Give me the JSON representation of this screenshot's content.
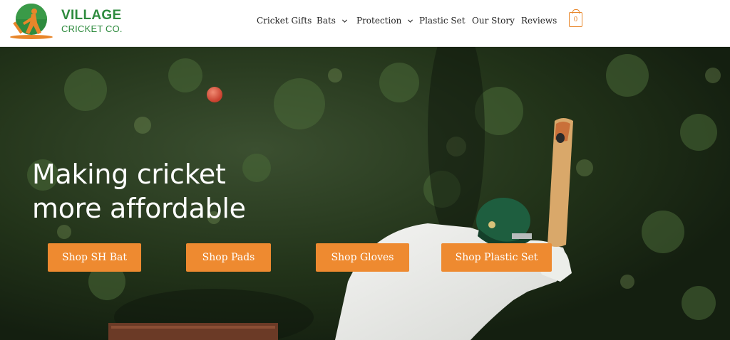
{
  "brand": {
    "name_line1": "VILLAGE",
    "name_line2": "CRICKET CO.",
    "green": "#2e8b3e",
    "orange": "#e8862a"
  },
  "nav": {
    "items": [
      {
        "label": "Cricket Gifts",
        "has_dropdown": false
      },
      {
        "label": "Bats",
        "has_dropdown": true
      },
      {
        "label": "Protection",
        "has_dropdown": true
      },
      {
        "label": "Plastic Set",
        "has_dropdown": false
      },
      {
        "label": "Our Story",
        "has_dropdown": false
      },
      {
        "label": "Reviews",
        "has_dropdown": false
      }
    ],
    "cart_count": "0",
    "cart_icon": "shopping-bag-icon"
  },
  "hero": {
    "headline_line1": "Making cricket",
    "headline_line2": "more affordable",
    "buttons": [
      {
        "label": "Shop SH Bat"
      },
      {
        "label": "Shop Pads"
      },
      {
        "label": "Shop Gloves"
      },
      {
        "label": "Shop Plastic Set"
      }
    ],
    "button_color": "#ee8a30"
  }
}
